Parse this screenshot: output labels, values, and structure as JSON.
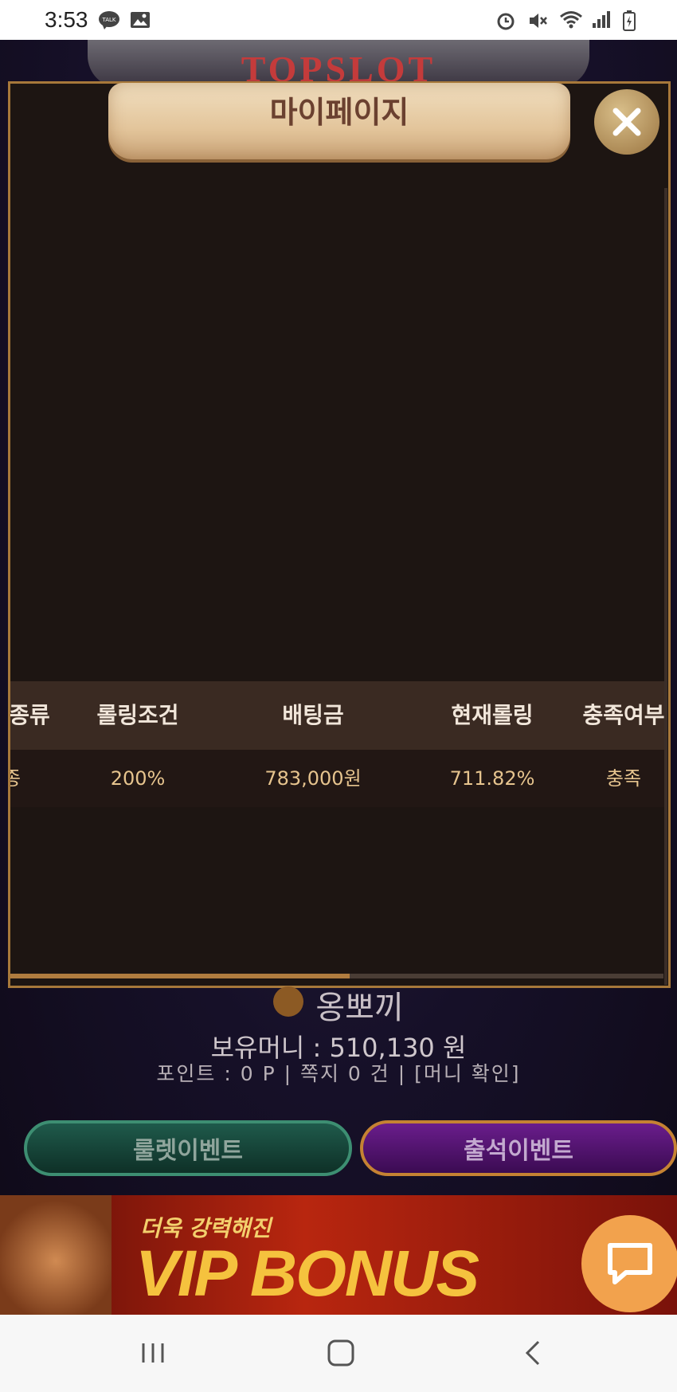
{
  "status_bar": {
    "time": "3:53",
    "left_icons": [
      "kakaotalk-icon",
      "gallery-icon"
    ],
    "right_icons": [
      "alarm-icon",
      "mute-icon",
      "wifi-icon",
      "signal-icon",
      "battery-icon"
    ]
  },
  "site": {
    "logo_text": "TOPSLOT"
  },
  "modal": {
    "title": "마이페이지",
    "close_icon": "close-icon",
    "table": {
      "headers": [
        "종류",
        "롤링조건",
        "배팅금",
        "현재롤링",
        "충족여부"
      ],
      "rows": [
        [
          "종",
          "200%",
          "783,000원",
          "711.82%",
          "충족"
        ]
      ]
    },
    "horizontal_scroll_fraction": 0.52
  },
  "account": {
    "username": "옹뽀끼",
    "money_line": "보유머니 : 510,130 원",
    "points_line": "포인트 : 0 P | 쪽지 0 건 | [머니 확인]"
  },
  "events": {
    "roulette_label": "룰렛이벤트",
    "attendance_label": "출석이벤트"
  },
  "banner": {
    "subtitle": "더욱 강력해진",
    "title": "VIP BONUS"
  },
  "chat": {
    "icon": "chat-bubble-icon"
  },
  "navbar": {
    "items": [
      "recent-apps-icon",
      "home-icon",
      "back-icon"
    ]
  },
  "colors": {
    "modal_border": "#a7783a",
    "table_header_bg": "#3a2a22",
    "table_value": "#e6c48e",
    "chat_button": "#f2a24d"
  }
}
